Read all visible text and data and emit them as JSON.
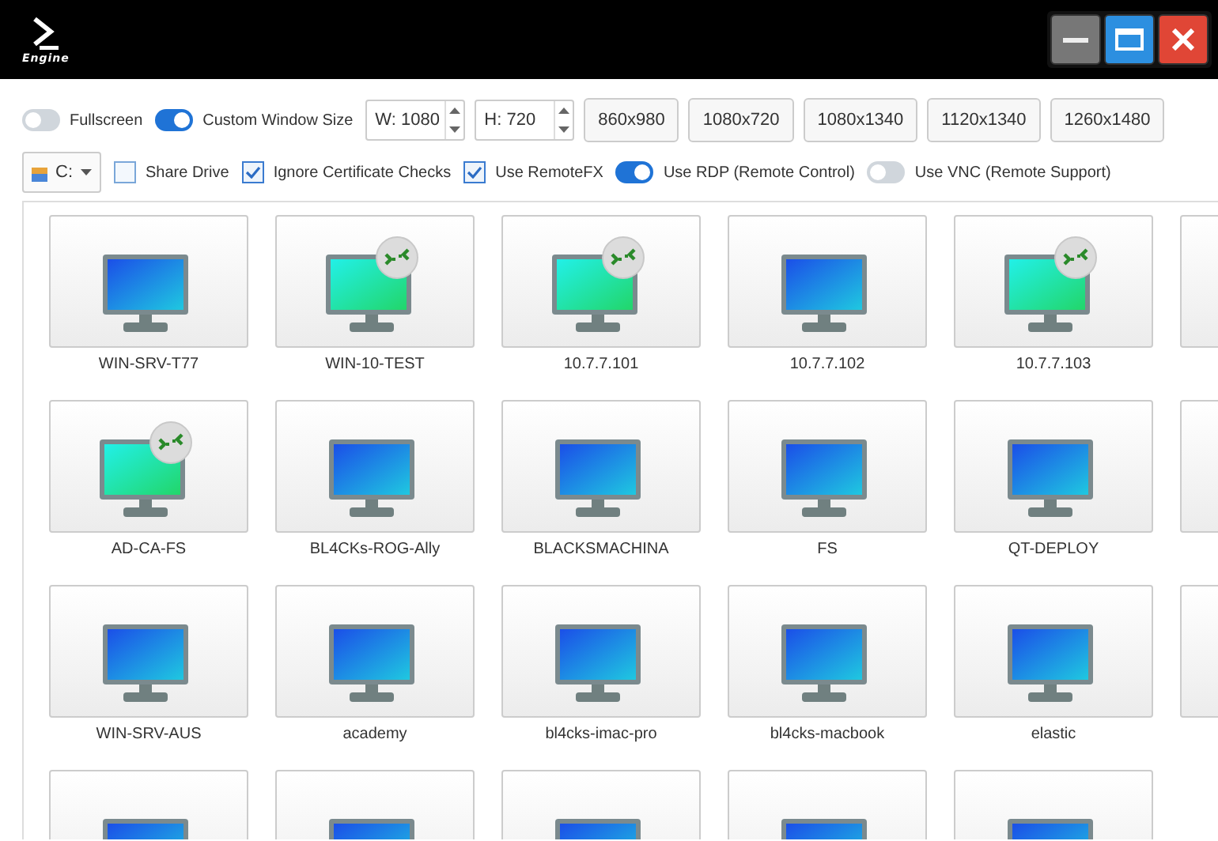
{
  "window": {
    "logo_text": "Engine",
    "buttons": [
      {
        "kind": "minimize"
      },
      {
        "kind": "maximize"
      },
      {
        "kind": "close"
      }
    ]
  },
  "options_row": [
    {
      "kind": "toggle",
      "label": "Fullscreen",
      "on": false
    },
    {
      "kind": "toggle",
      "label": "Custom Window Size",
      "on": true
    },
    {
      "kind": "spin",
      "value": "W: 1080"
    },
    {
      "kind": "spin",
      "value": "H: 720"
    },
    {
      "kind": "preset",
      "label": "860x980"
    },
    {
      "kind": "preset",
      "label": "1080x720"
    },
    {
      "kind": "preset",
      "label": "1080x1340"
    },
    {
      "kind": "preset",
      "label": "1120x1340"
    },
    {
      "kind": "preset",
      "label": "1260x1480"
    }
  ],
  "settings_row": [
    {
      "kind": "drive",
      "value": "C:"
    },
    {
      "kind": "checkbox",
      "label": "Share Drive",
      "checked": false
    },
    {
      "kind": "checkbox",
      "label": "Ignore Certificate Checks",
      "checked": true
    },
    {
      "kind": "checkbox",
      "label": "Use RemoteFX",
      "checked": true
    },
    {
      "kind": "toggle",
      "label": "Use RDP (Remote Control)",
      "on": true
    },
    {
      "kind": "toggle",
      "label": "Use VNC (Remote Support)",
      "on": false
    }
  ],
  "host_rows": [
    {
      "cut_tile": true,
      "tiles": [
        {
          "label": "WIN-SRV-T77",
          "connected": false
        },
        {
          "label": "WIN-10-TEST",
          "connected": true
        },
        {
          "label": "10.7.7.101",
          "connected": true
        },
        {
          "label": "10.7.7.102",
          "connected": false
        },
        {
          "label": "10.7.7.103",
          "connected": true
        }
      ]
    },
    {
      "cut_tile": true,
      "tiles": [
        {
          "label": "AD-CA-FS",
          "connected": true
        },
        {
          "label": "BL4CKs-ROG-Ally",
          "connected": false
        },
        {
          "label": "BLACKSMACHINA",
          "connected": false
        },
        {
          "label": "FS",
          "connected": false
        },
        {
          "label": "QT-DEPLOY",
          "connected": false
        }
      ]
    },
    {
      "cut_tile": true,
      "tiles": [
        {
          "label": "WIN-SRV-AUS",
          "connected": false
        },
        {
          "label": "academy",
          "connected": false
        },
        {
          "label": "bl4cks-imac-pro",
          "connected": false
        },
        {
          "label": "bl4cks-macbook",
          "connected": false
        },
        {
          "label": "elastic",
          "connected": false
        }
      ]
    },
    {
      "cut_tile": false,
      "tiles": [
        {
          "connected": false
        },
        {
          "connected": false
        },
        {
          "connected": false
        },
        {
          "connected": false
        },
        {
          "connected": false
        }
      ]
    }
  ]
}
